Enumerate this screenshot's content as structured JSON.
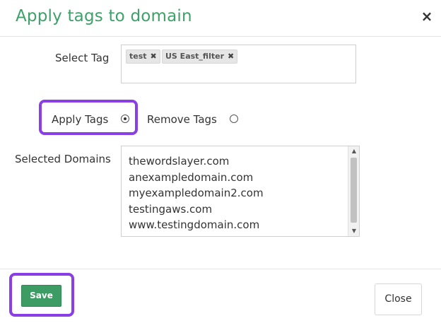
{
  "dialog": {
    "title": "Apply tags to domain",
    "close_icon": "×",
    "accent_color": "#3fa06a",
    "highlight_color": "#8a3ee6"
  },
  "select_tag": {
    "label": "Select Tag",
    "tags": [
      {
        "label": "test",
        "remove_icon": "✖"
      },
      {
        "label": "US East_filter",
        "remove_icon": "✖"
      }
    ]
  },
  "action": {
    "options": [
      {
        "label": "Apply Tags",
        "selected": true
      },
      {
        "label": "Remove Tags",
        "selected": false
      }
    ]
  },
  "selected_domains": {
    "label": "Selected Domains",
    "items": [
      "thewordslayer.com",
      "anexampledomain.com",
      "myexampledomain2.com",
      "testingaws.com",
      "www.testingdomain.com"
    ]
  },
  "footer": {
    "save_label": "Save",
    "close_label": "Close"
  }
}
